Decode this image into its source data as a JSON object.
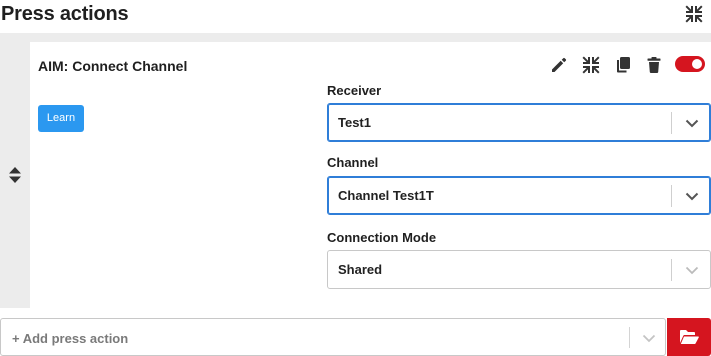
{
  "header": {
    "title": "Press actions",
    "collapse_icon": "compress-arrows-icon"
  },
  "action": {
    "title": "AIM: Connect Channel",
    "learn_label": "Learn",
    "toolbar": {
      "edit_icon": "pencil-icon",
      "collapse_icon": "compress-arrows-icon",
      "copy_icon": "copy-icon",
      "delete_icon": "trash-icon",
      "enabled": true
    },
    "fields": [
      {
        "label": "Receiver",
        "value": "Test1",
        "focused": true
      },
      {
        "label": "Channel",
        "value": "Channel Test1T",
        "focused": true
      },
      {
        "label": "Connection Mode",
        "value": "Shared",
        "focused": false
      }
    ]
  },
  "add_action": {
    "placeholder": "+ Add press action",
    "open_icon": "folder-open-icon"
  },
  "colors": {
    "accent_blue": "#2b98f0",
    "danger_red": "#d5151f",
    "focus_border": "#2f7ed8",
    "panel_gray": "#ececec"
  }
}
